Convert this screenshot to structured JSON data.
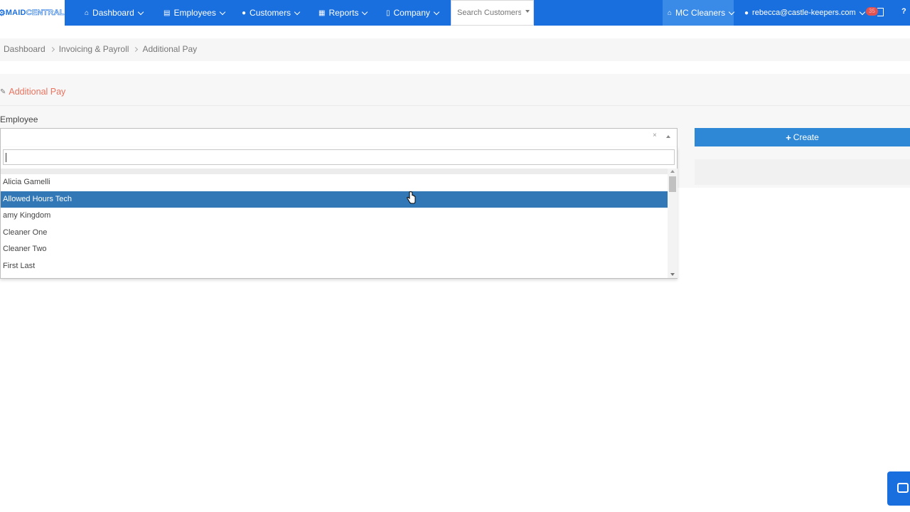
{
  "brand": {
    "logo_word1": "MAID",
    "logo_word2": "CENTRAL"
  },
  "nav": {
    "dashboard": "Dashboard",
    "employees": "Employees",
    "customers": "Customers",
    "reports": "Reports",
    "company": "Company",
    "search_placeholder": "Search Customers",
    "company_selector": "MC Cleaners",
    "user_email": "rebecca@castle-keepers.com",
    "notification_count": "35"
  },
  "breadcrumb": [
    "Dashboard",
    "Invoicing & Payroll",
    "Additional Pay"
  ],
  "page": {
    "title": "Additional Pay",
    "employee_label": "Employee",
    "clear_symbol": "×",
    "create_label": "Create",
    "create_icon": "plus-icon"
  },
  "dropdown": {
    "search_value": "",
    "options": [
      "Alicia Gamelli",
      "Allowed Hours Tech",
      "amy Kingdom",
      "Cleaner One",
      "Cleaner Two",
      "First Last"
    ],
    "highlighted_option": "Allowed Hours Tech"
  },
  "colors": {
    "nav_bg": "#1a6fdf",
    "title_accent": "#e8735f",
    "create_button": "#2f88d6",
    "highlight": "#3278b6"
  }
}
